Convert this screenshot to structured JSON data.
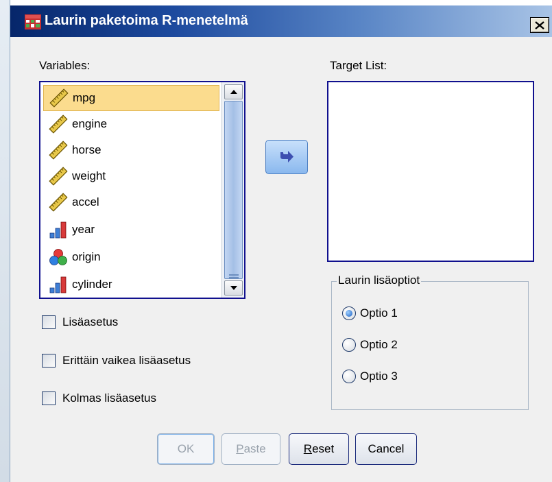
{
  "window": {
    "title": "Laurin paketoima R-menetelmä",
    "close_label": "X"
  },
  "variables": {
    "label": "Variables:",
    "items": [
      {
        "name": "mpg",
        "icon": "scale-ruler-icon",
        "selected": true
      },
      {
        "name": "engine",
        "icon": "scale-ruler-icon",
        "selected": false
      },
      {
        "name": "horse",
        "icon": "scale-ruler-icon",
        "selected": false
      },
      {
        "name": "weight",
        "icon": "scale-ruler-icon",
        "selected": false
      },
      {
        "name": "accel",
        "icon": "scale-ruler-icon",
        "selected": false
      },
      {
        "name": "year",
        "icon": "ordinal-bars-icon",
        "selected": false
      },
      {
        "name": "origin",
        "icon": "nominal-circles-icon",
        "selected": false
      },
      {
        "name": "cylinder",
        "icon": "ordinal-bars-icon",
        "selected": false
      }
    ]
  },
  "target": {
    "label": "Target List:"
  },
  "options_group": {
    "legend": "Laurin lisäoptiot",
    "options": [
      {
        "label": "Optio 1",
        "checked": true
      },
      {
        "label": "Optio 2",
        "checked": false
      },
      {
        "label": "Optio 3",
        "checked": false
      }
    ]
  },
  "checkboxes": [
    {
      "label": "Lisäasetus",
      "checked": false
    },
    {
      "label": "Erittäin vaikea lisäasetus",
      "checked": false
    },
    {
      "label": "Kolmas lisäasetus",
      "checked": false
    }
  ],
  "buttons": {
    "ok": "OK",
    "paste_mnemonic": "P",
    "paste_rest": "aste",
    "reset_mnemonic": "R",
    "reset_rest": "eset",
    "cancel": "Cancel"
  },
  "colors": {
    "title_gradient_start": "#06266a",
    "title_gradient_end": "#a9c4e6",
    "selection": "#fbdc8e",
    "listbox_border": "#10108e",
    "dialog_bg": "#f0f0f0"
  }
}
